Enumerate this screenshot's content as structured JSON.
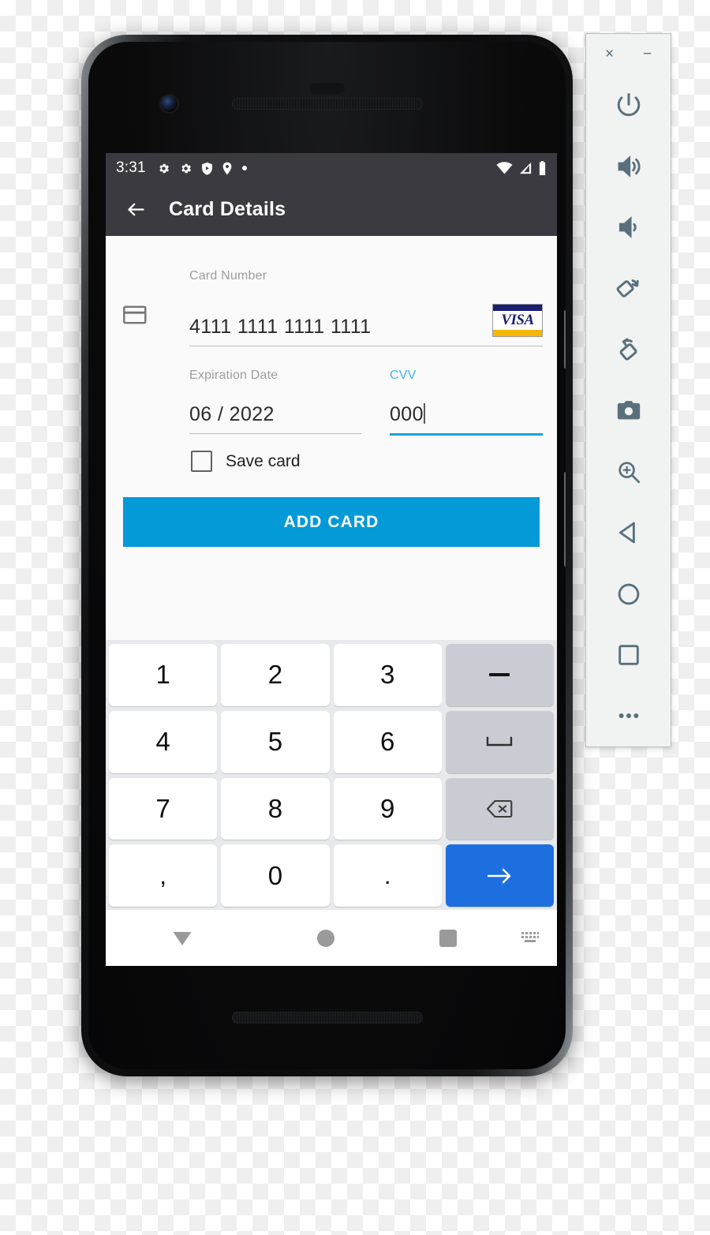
{
  "device": {
    "hardware": {
      "front_camera": "front-camera",
      "earpiece": "earpiece-speaker",
      "bottom_speaker": "bottom-speaker",
      "power_button": "power-button",
      "volume_button": "volume-button"
    }
  },
  "status_bar": {
    "time": "3:31",
    "left_icons": [
      "gear-icon",
      "gear-icon",
      "shield-play-icon",
      "location-pin-icon",
      "dot-icon"
    ],
    "right_icons": [
      "wifi-icon",
      "cellular-signal-icon",
      "battery-icon"
    ]
  },
  "app_bar": {
    "back_icon": "back-arrow-icon",
    "title": "Card Details"
  },
  "form": {
    "card_icon": "credit-card-icon",
    "card_number": {
      "label": "Card Number",
      "value": "4111 1111 1111 1111",
      "brand_logo": "visa-logo",
      "brand_text": "VISA",
      "focused": false
    },
    "expiration": {
      "label": "Expiration Date",
      "value": "06 / 2022",
      "focused": false
    },
    "cvv": {
      "label": "CVV",
      "value": "000",
      "focused": true
    },
    "save_card": {
      "label": "Save card",
      "checked": false
    },
    "submit": {
      "label": "ADD CARD"
    },
    "colors": {
      "accent": "#039ad7",
      "focus_underline": "#18a3e0",
      "focus_label": "#41b6f0",
      "app_bar": "#3b3a40",
      "visa_navy": "#1a1f71",
      "visa_gold": "#f7b600"
    }
  },
  "keyboard": {
    "rows": [
      [
        {
          "label": "1",
          "type": "digit"
        },
        {
          "label": "2",
          "type": "digit"
        },
        {
          "label": "3",
          "type": "digit"
        },
        {
          "label": "–",
          "type": "func",
          "name": "minus-key"
        }
      ],
      [
        {
          "label": "4",
          "type": "digit"
        },
        {
          "label": "5",
          "type": "digit"
        },
        {
          "label": "6",
          "type": "digit"
        },
        {
          "label": "⌴",
          "type": "func",
          "name": "space-key"
        }
      ],
      [
        {
          "label": "7",
          "type": "digit"
        },
        {
          "label": "8",
          "type": "digit"
        },
        {
          "label": "9",
          "type": "digit"
        },
        {
          "label": "⌫",
          "type": "func",
          "name": "backspace-key"
        }
      ],
      [
        {
          "label": ",",
          "type": "punct"
        },
        {
          "label": "0",
          "type": "digit"
        },
        {
          "label": ".",
          "type": "punct"
        },
        {
          "label": "→",
          "type": "enter",
          "name": "enter-key"
        }
      ]
    ],
    "colors": {
      "background": "#e7e9ec",
      "key": "#ffffff",
      "function_key": "#c9ccd2",
      "enter_key": "#1d6fe0"
    }
  },
  "nav_bar": {
    "items": [
      {
        "name": "nav-back-icon",
        "shape": "down-triangle"
      },
      {
        "name": "nav-home-icon",
        "shape": "circle"
      },
      {
        "name": "nav-recents-icon",
        "shape": "square"
      },
      {
        "name": "nav-keyboard-icon",
        "shape": "keyboard"
      }
    ],
    "icon_color": "#9a9a9a"
  },
  "emulator_toolbar": {
    "window_controls": [
      {
        "name": "close-window-button",
        "glyph": "×"
      },
      {
        "name": "minimize-window-button",
        "glyph": "−"
      }
    ],
    "buttons": [
      {
        "name": "power-button",
        "icon": "power-icon"
      },
      {
        "name": "volume-up-button",
        "icon": "volume-up-icon"
      },
      {
        "name": "volume-down-button",
        "icon": "volume-down-icon"
      },
      {
        "name": "rotate-left-button",
        "icon": "rotate-left-icon"
      },
      {
        "name": "rotate-right-button",
        "icon": "rotate-right-icon"
      },
      {
        "name": "screenshot-button",
        "icon": "camera-icon"
      },
      {
        "name": "zoom-button",
        "icon": "zoom-in-icon"
      },
      {
        "name": "back-button",
        "icon": "back-triangle-icon"
      },
      {
        "name": "home-button",
        "icon": "circle-icon"
      },
      {
        "name": "overview-button",
        "icon": "square-icon"
      },
      {
        "name": "more-button",
        "icon": "ellipsis-icon"
      }
    ],
    "icon_color": "#59707c"
  }
}
